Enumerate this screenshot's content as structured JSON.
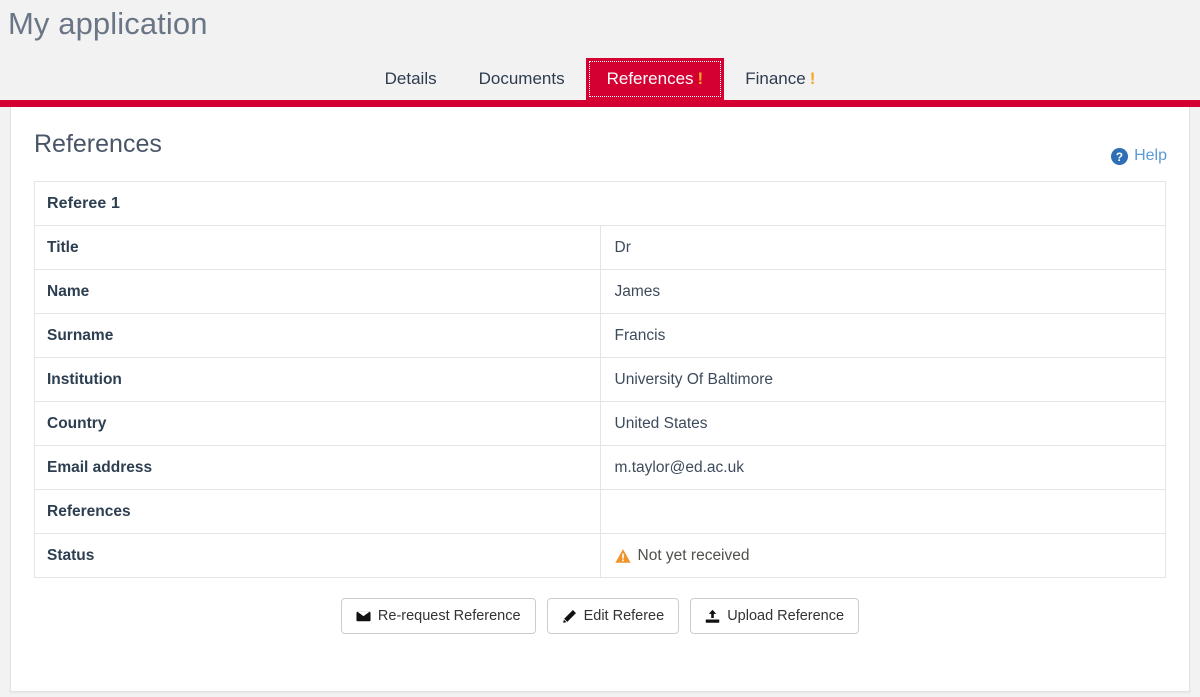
{
  "header": {
    "app_title": "My application"
  },
  "tabs": [
    {
      "label": "Details",
      "active": false,
      "alert": false
    },
    {
      "label": "Documents",
      "active": false,
      "alert": false
    },
    {
      "label": "References",
      "active": true,
      "alert": true,
      "alert_mark": "!"
    },
    {
      "label": "Finance",
      "active": false,
      "alert": true,
      "alert_mark": "!"
    }
  ],
  "panel": {
    "section_title": "References",
    "help_label": "Help",
    "help_icon": "question-circle-icon"
  },
  "table": {
    "group_header": "Referee 1",
    "rows": [
      {
        "label": "Title",
        "value": "Dr"
      },
      {
        "label": "Name",
        "value": "James"
      },
      {
        "label": "Surname",
        "value": "Francis"
      },
      {
        "label": "Institution",
        "value": "University Of Baltimore"
      },
      {
        "label": "Country",
        "value": "United States"
      },
      {
        "label": "Email address",
        "value": "m.taylor@ed.ac.uk"
      },
      {
        "label": "References",
        "value": ""
      }
    ],
    "status_row": {
      "label": "Status",
      "value": "Not yet received",
      "icon": "warning-triangle-icon"
    }
  },
  "actions": [
    {
      "label": "Re-request Reference",
      "icon": "envelope-icon"
    },
    {
      "label": "Edit Referee",
      "icon": "pencil-icon"
    },
    {
      "label": "Upload Reference",
      "icon": "upload-icon"
    }
  ],
  "colors": {
    "brand_red": "#d50032",
    "alert_orange": "#f5a623",
    "help_blue": "#5b9bd5",
    "page_bg": "#f2f2f2"
  }
}
